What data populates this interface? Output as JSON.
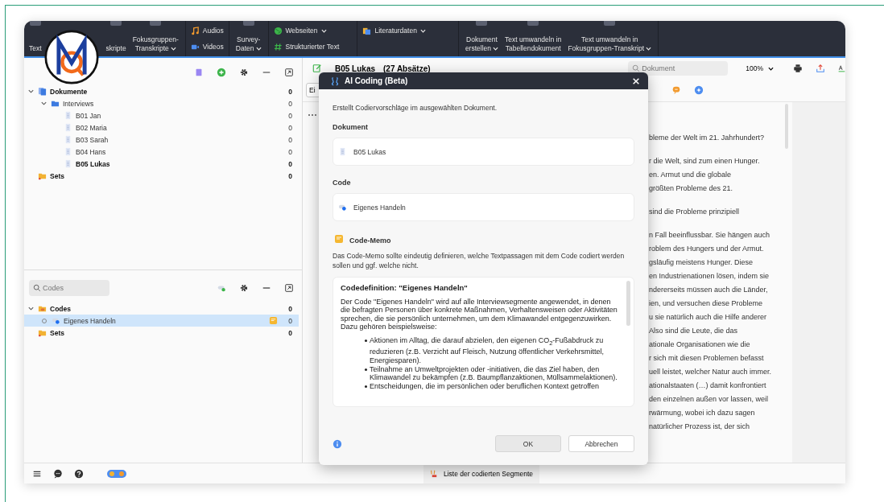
{
  "toolbar": {
    "groups": [
      {
        "items": [
          {
            "kind": "big",
            "lines": [
              "Text"
            ],
            "dropdown": false
          },
          {
            "kind": "big",
            "lines": [
              "skripte"
            ],
            "dropdown": false
          },
          {
            "kind": "big",
            "lines": [
              "Fokusgruppen-",
              "Transkripte"
            ],
            "dropdown": true
          }
        ]
      },
      {
        "items": [
          {
            "kind": "small",
            "label": "Audios",
            "dropdown": false
          },
          {
            "kind": "small",
            "label": "Videos",
            "dropdown": false
          }
        ]
      },
      {
        "items": [
          {
            "kind": "big",
            "lines": [
              "Survey-",
              "Daten"
            ],
            "dropdown": true
          }
        ]
      },
      {
        "items": [
          {
            "kind": "small",
            "label": "Webseiten",
            "dropdown": true
          },
          {
            "kind": "small",
            "label": "Strukturierter Text",
            "dropdown": false
          }
        ]
      },
      {
        "items": [
          {
            "kind": "small",
            "label": "Literaturdaten",
            "dropdown": true
          }
        ]
      },
      {
        "items": [
          {
            "kind": "big",
            "lines": [
              "Dokument",
              "erstellen"
            ],
            "dropdown": true
          },
          {
            "kind": "big",
            "lines": [
              "Text umwandeln in",
              "Tabellendokument"
            ],
            "dropdown": false
          },
          {
            "kind": "big",
            "lines": [
              "Text umwandeln in",
              "Fokusgruppen-Transkript"
            ],
            "dropdown": true
          }
        ]
      }
    ]
  },
  "documents": {
    "tree": [
      {
        "kind": "root",
        "label": "Dokumente",
        "count": "0",
        "bold": true,
        "expanded": true,
        "selected": false,
        "children": [
          {
            "kind": "folder",
            "label": "Interviews",
            "count": "0",
            "bold": false,
            "expanded": true,
            "selected": false,
            "children": [
              {
                "kind": "doc",
                "label": "B01 Jan",
                "count": "0",
                "bold": false,
                "selected": false
              },
              {
                "kind": "doc",
                "label": "B02 Maria",
                "count": "0",
                "bold": false,
                "selected": false
              },
              {
                "kind": "doc",
                "label": "B03 Sarah",
                "count": "0",
                "bold": false,
                "selected": false
              },
              {
                "kind": "doc",
                "label": "B04 Hans",
                "count": "0",
                "bold": false,
                "selected": false
              },
              {
                "kind": "doc",
                "label": "B05 Lukas",
                "count": "0",
                "bold": true,
                "selected": false
              }
            ]
          }
        ]
      },
      {
        "kind": "sets",
        "label": "Sets",
        "count": "0",
        "bold": true,
        "selected": false
      }
    ]
  },
  "codes": {
    "search": {
      "placeholder": "Codes"
    },
    "tree": [
      {
        "kind": "codes",
        "label": "Codes",
        "count": "0",
        "bold": true,
        "expanded": true,
        "selected": false,
        "children": [
          {
            "kind": "code",
            "label": "Eigenes Handeln",
            "count": "0",
            "bold": false,
            "selected": true,
            "memo": true,
            "color": "#1e6ef0"
          }
        ]
      },
      {
        "kind": "sets",
        "label": "Sets",
        "count": "0",
        "bold": true,
        "selected": false
      }
    ]
  },
  "document_browser": {
    "title": "B05 Lukas",
    "subtitle": "(27 Absätze)",
    "search": {
      "placeholder": "Dokument"
    },
    "zoom": "100%",
    "code_field": "Ei",
    "paragraphs": [
      {
        "lines": [
          "bleme der Welt im 21. Jahrhundert?"
        ]
      },
      {
        "lines": [
          "r die Welt, sind zum einen Hunger.",
          "en. Armut und die globale",
          "größten Probleme des 21."
        ]
      },
      {
        "lines": [
          "sind die Probleme prinzipiell"
        ]
      },
      {
        "lines": [
          "n Fall beeinflussbar. Sie hängen auch",
          "roblem des Hungers und der Armut.",
          "gsläufig meistens Hunger. Diese",
          "en Industrienationen lösen, indem sie",
          "ndererseits müssen auch die Länder,",
          "ien, und versuchen diese Probleme",
          "u sie natürlich auch die Hilfe anderer",
          "Also sind die Leute, die das",
          "ationale Organisationen wie die",
          "r sich mit diesen Problemen befasst",
          "uell leistet, welcher Natur auch immer.",
          "ationalstaaten (…) damit konfrontiert",
          "den einzelnen außen vor lassen, weil",
          "rwärmung, wobei ich dazu sagen",
          "natürlicher Prozess ist, der sich"
        ]
      }
    ]
  },
  "dialog": {
    "title": "AI Coding (Beta)",
    "description": "Erstellt Codiervorschläge im ausgewählten Dokument.",
    "document_label": "Dokument",
    "document_value": "B05 Lukas",
    "code_label": "Code",
    "code_value": "Eigenes Handeln",
    "memo_label": "Code-Memo",
    "memo_hint": "Das Code-Memo sollte eindeutig definieren, welche Textpassagen mit dem Code codiert werden sollen und ggf. welche nicht.",
    "memo": {
      "heading": "Codedefinition: \"Eigenes Handeln\"",
      "paragraph": "Der Code \"Eigenes Handeln\" wird auf alle Interviewsegmente angewendet, in denen die befragten Personen über konkrete Maßnahmen, Verhaltensweisen oder Aktivitäten sprechen, die sie persönlich unternehmen, um dem Klimawandel entgegenzuwirken. Dazu gehören beispielsweise:",
      "bullets": [
        "Aktionen im Alltag, die darauf abzielen, den eigenen CO$_{2}$-Fußabdruck zu reduzieren (z.B. Verzicht auf Fleisch, Nutzung öffentlicher Verkehrsmittel, Energiesparen).",
        "Teilnahme an Umweltprojekten oder -initiativen, die das Ziel haben, den Klimawandel zu bekämpfen (z.B. Baumpflanzaktionen, Müllsammelaktionen).",
        "Entscheidungen, die im persönlichen oder beruflichen Kontext getroffen"
      ]
    },
    "buttons": [
      {
        "label": "OK",
        "highlighted": true
      },
      {
        "label": "Abbrechen",
        "highlighted": false
      }
    ]
  },
  "status_bar": {
    "label": "Liste der codierten Segmente"
  }
}
